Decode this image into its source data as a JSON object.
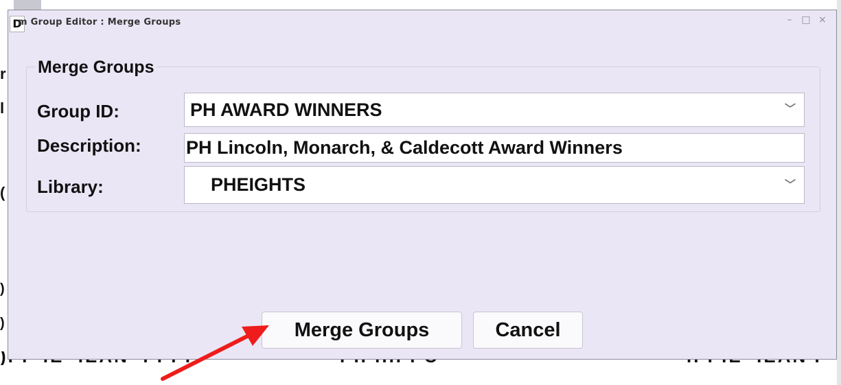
{
  "window": {
    "icon_letter": "D",
    "title": "m Group Editor : Merge Groups",
    "controls": {
      "minimize": "–",
      "maximize": "□",
      "close": "×"
    }
  },
  "form": {
    "legend": "Merge Groups",
    "group_id": {
      "label": "Group ID:",
      "value": "PH AWARD WINNERS"
    },
    "description": {
      "label": "Description:",
      "value": "PH Lincoln, Monarch, & Caldecott Award Winners"
    },
    "library": {
      "label": "Library:",
      "value": "PHEIGHTS"
    }
  },
  "buttons": {
    "merge": "Merge Groups",
    "cancel": "Cancel"
  },
  "annotation": {
    "arrow_color": "#ee1c1c"
  }
}
